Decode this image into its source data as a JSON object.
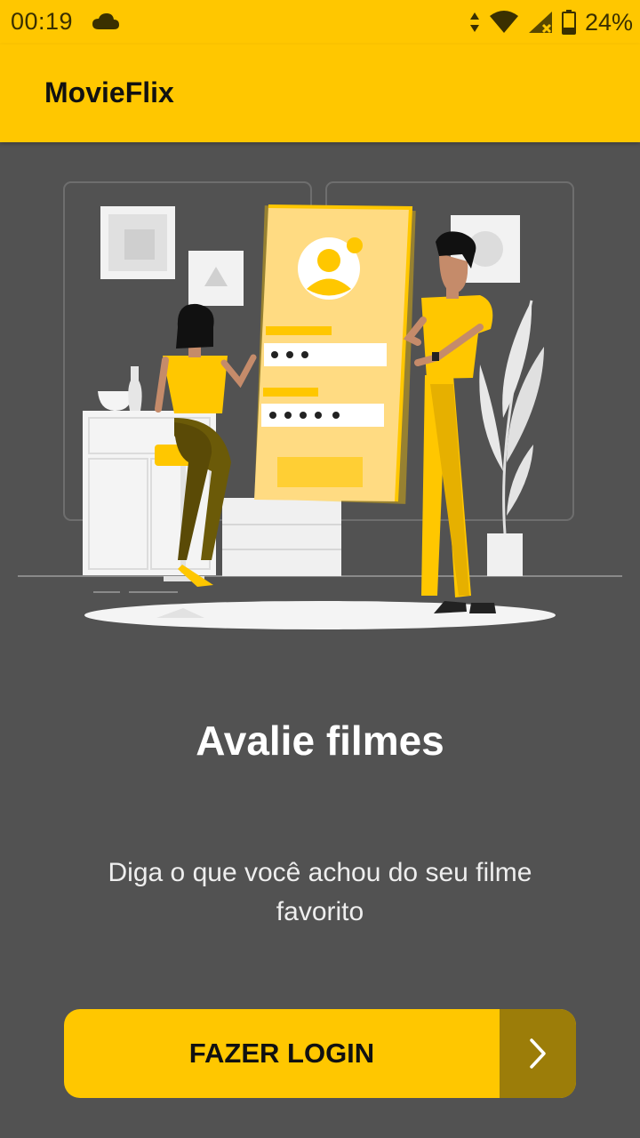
{
  "status_bar": {
    "time": "00:19",
    "battery_percent": "24%",
    "icons": [
      "cloud-icon",
      "data-arrows-icon",
      "wifi-icon",
      "signal-icon",
      "battery-icon"
    ]
  },
  "app_bar": {
    "title": "MovieFlix"
  },
  "onboarding": {
    "illustration": "people-login-illustration",
    "headline": "Avalie filmes",
    "subtitle": "Diga o que você achou do seu filme favorito",
    "login_button": {
      "label": "FAZER LOGIN",
      "icon": "chevron-right-icon"
    }
  },
  "colors": {
    "primary": "#FFC700",
    "background": "#525252",
    "button_arrow_bg": "#9C7D09"
  }
}
